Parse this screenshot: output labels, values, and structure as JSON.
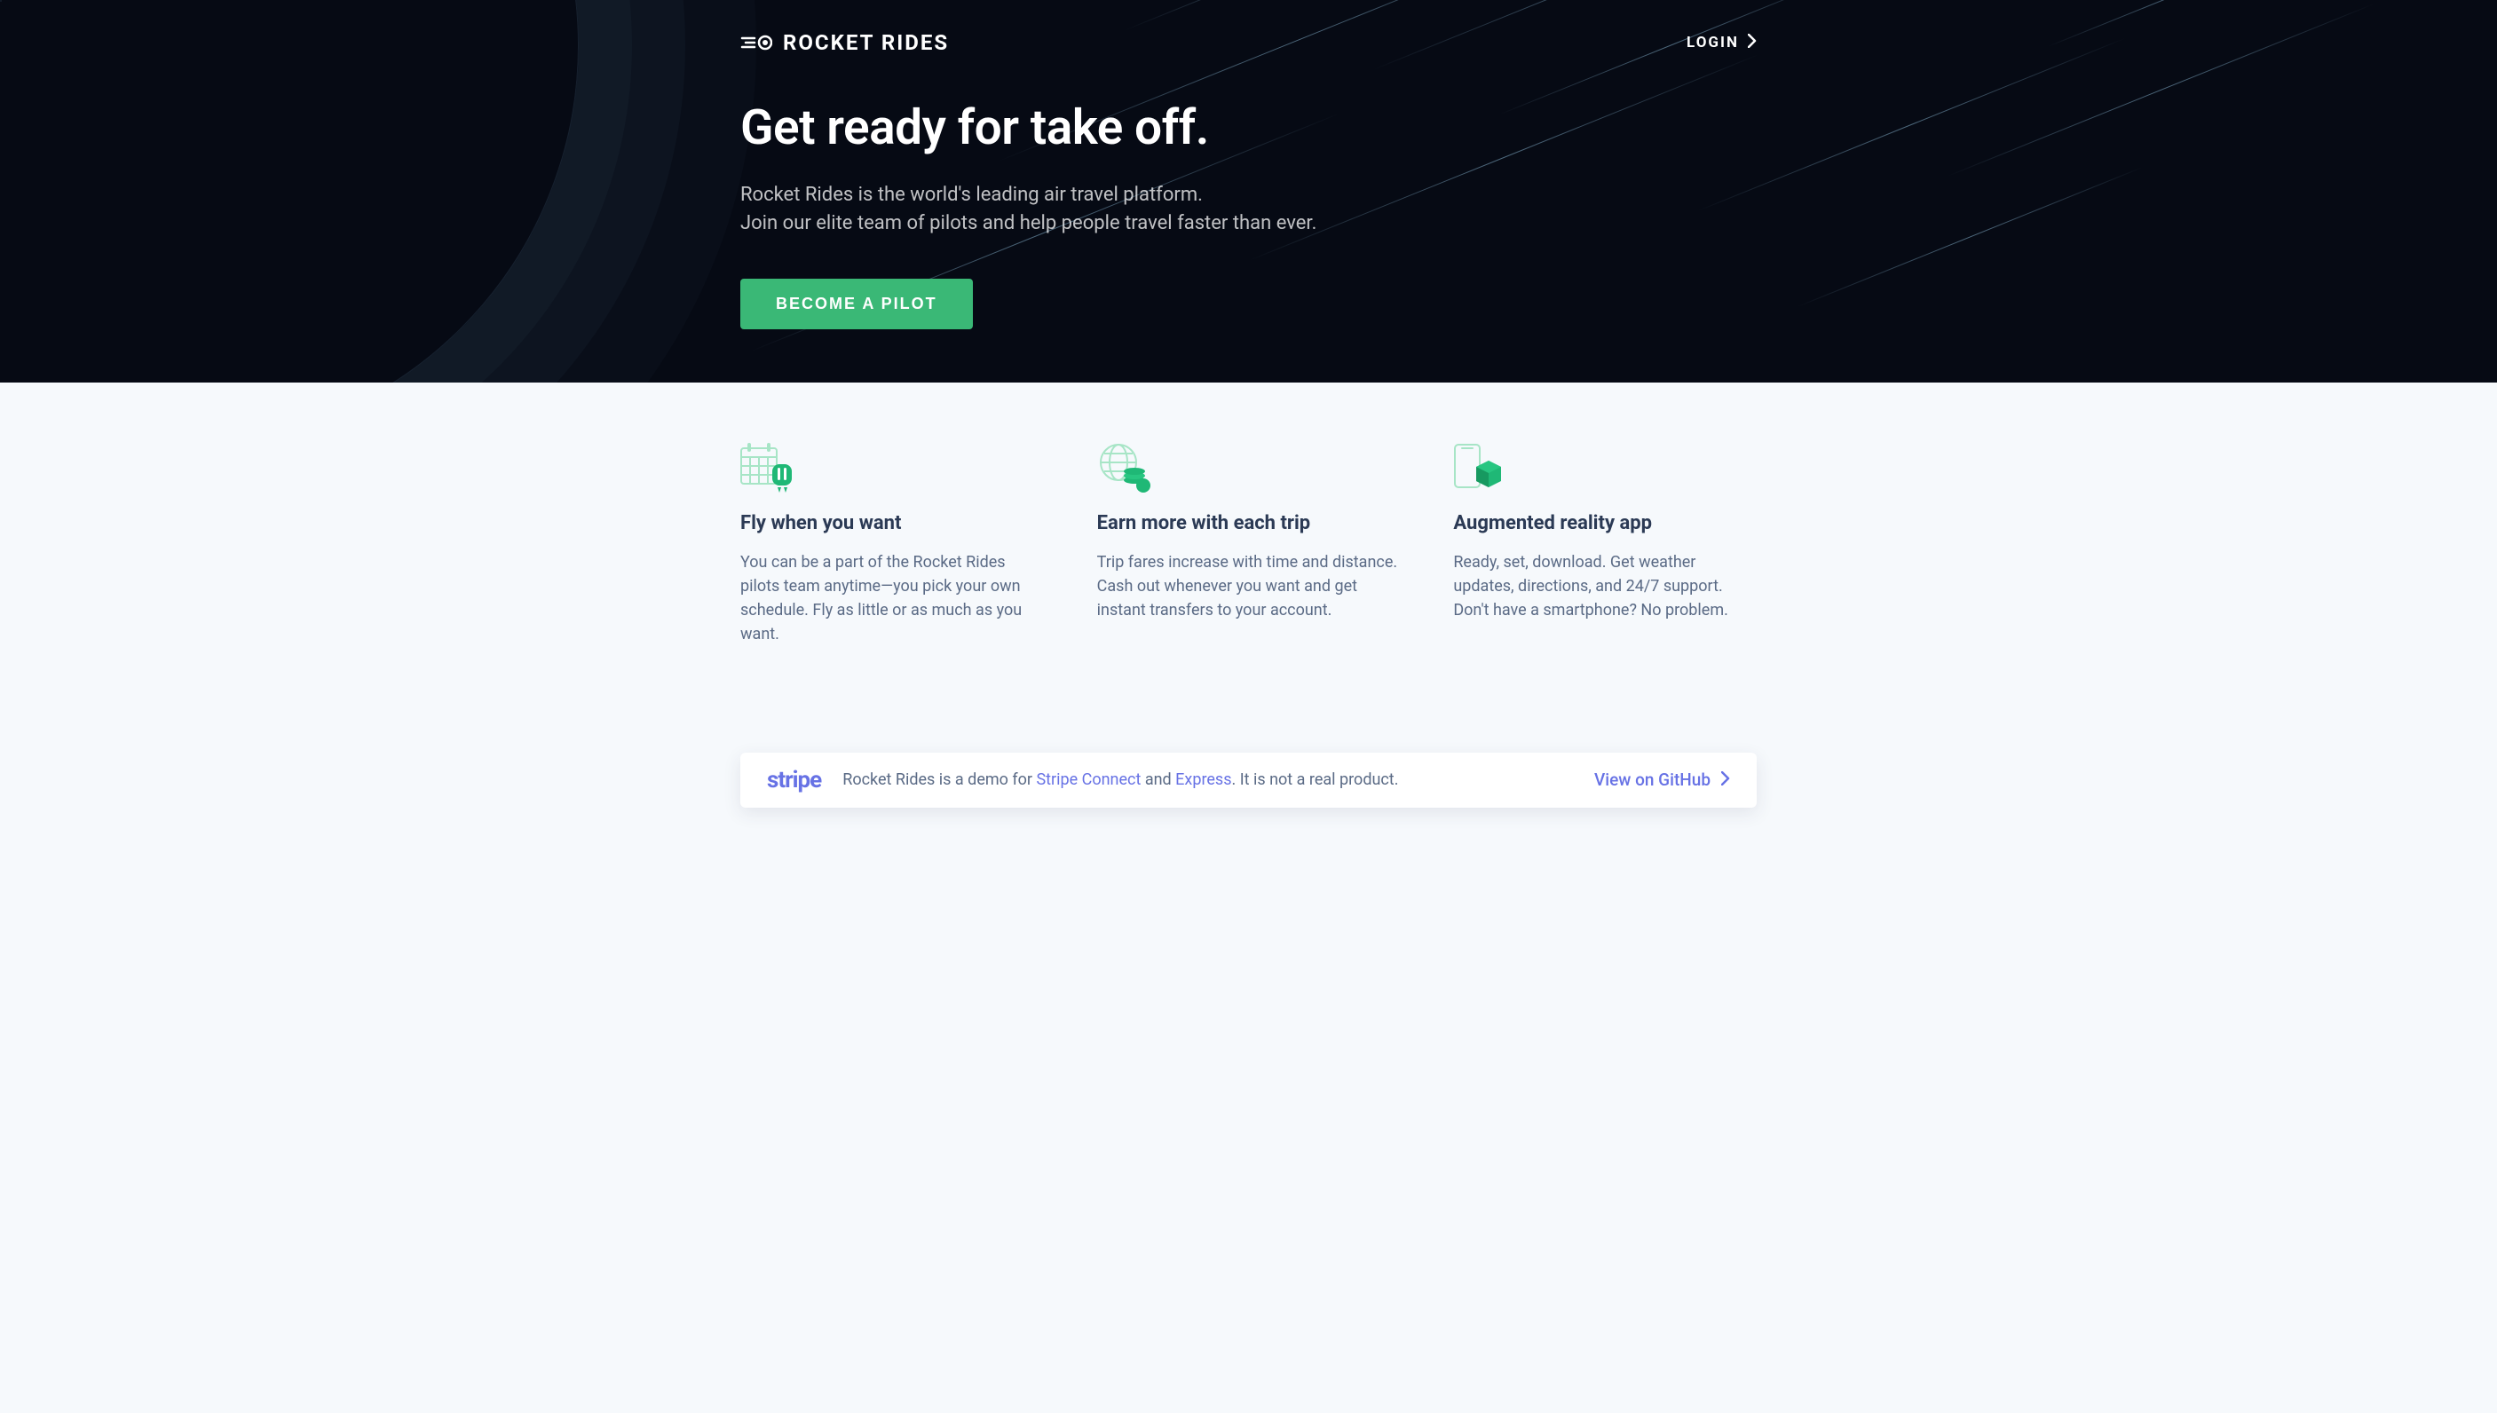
{
  "brand": {
    "name": "ROCKET RIDES"
  },
  "nav": {
    "login": "LOGIN"
  },
  "hero": {
    "title": "Get ready for take off.",
    "subtitle_line1": "Rocket Rides is the world's leading air travel platform.",
    "subtitle_line2": "Join our elite team of pilots and help people travel faster than ever.",
    "cta": "BECOME A PILOT"
  },
  "features": [
    {
      "title": "Fly when you want",
      "body": "You can be a part of the Rocket Rides pilots team anytime—you pick your own schedule. Fly as little or as much as you want."
    },
    {
      "title": "Earn more with each trip",
      "body": "Trip fares increase with time and distance. Cash out whenever you want and get instant transfers to your account."
    },
    {
      "title": "Augmented reality app",
      "body": "Ready, set, download. Get weather updates, directions, and 24/7 support. Don't have a smartphone? No problem."
    }
  ],
  "banner": {
    "stripe": "stripe",
    "text_prefix": "Rocket Rides is a demo for ",
    "link1": "Stripe Connect",
    "text_mid": " and ",
    "link2": "Express",
    "text_suffix": ". It is not a real product.",
    "github": "View on GitHub"
  }
}
